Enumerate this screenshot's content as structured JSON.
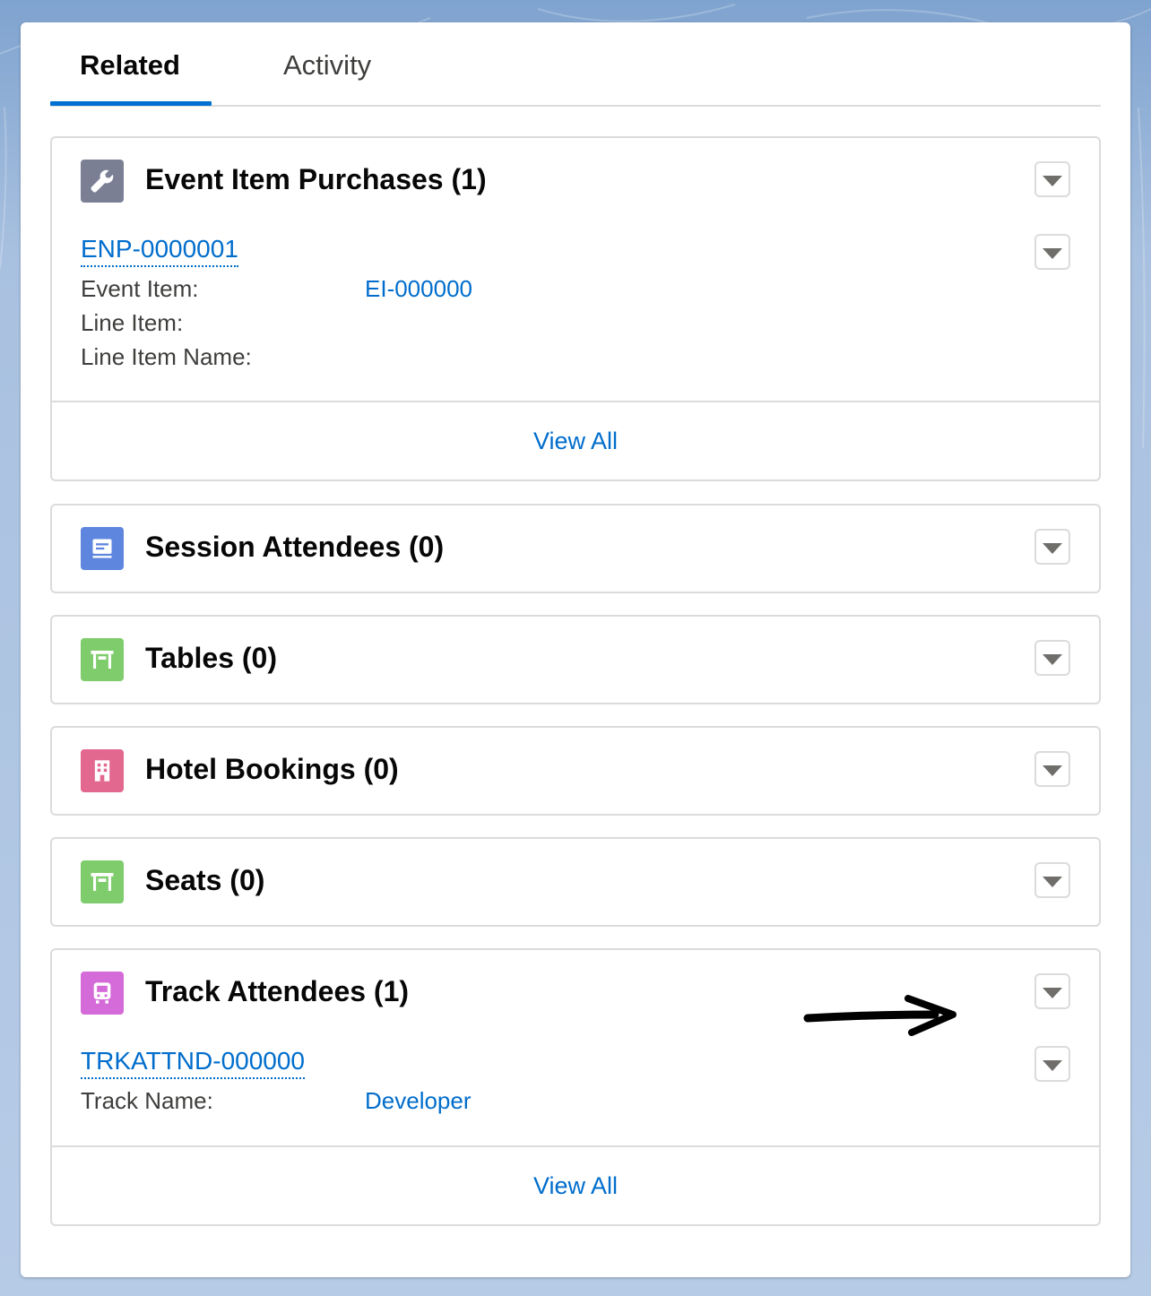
{
  "tabs": [
    {
      "label": "Related",
      "active": true
    },
    {
      "label": "Activity",
      "active": false
    }
  ],
  "cards": {
    "event_item_purchases": {
      "title": "Event Item Purchases (1)",
      "icon": "wrench-icon",
      "icon_color": "#7a7f94",
      "record": {
        "name": "ENP-0000001",
        "fields": [
          {
            "label": "Event Item:",
            "value": "EI-000000"
          },
          {
            "label": "Line Item:",
            "value": ""
          },
          {
            "label": "Line Item Name:",
            "value": ""
          }
        ]
      },
      "footer": "View All"
    },
    "session_attendees": {
      "title": "Session Attendees (0)",
      "icon": "session-icon",
      "icon_color": "#5f86df"
    },
    "tables": {
      "title": "Tables (0)",
      "icon": "table-icon",
      "icon_color": "#7fcc6c"
    },
    "hotel_bookings": {
      "title": "Hotel Bookings (0)",
      "icon": "hotel-icon",
      "icon_color": "#e3688f"
    },
    "seats": {
      "title": "Seats (0)",
      "icon": "seat-icon",
      "icon_color": "#7fcc6c"
    },
    "track_attendees": {
      "title": "Track Attendees (1)",
      "icon": "track-icon",
      "icon_color": "#d46bd9",
      "record": {
        "name": "TRKATTND-000000",
        "fields": [
          {
            "label": "Track Name:",
            "value": "Developer"
          }
        ]
      },
      "footer": "View All"
    }
  },
  "colors": {
    "link": "#006dcc",
    "tab_active": "#0070d2"
  }
}
